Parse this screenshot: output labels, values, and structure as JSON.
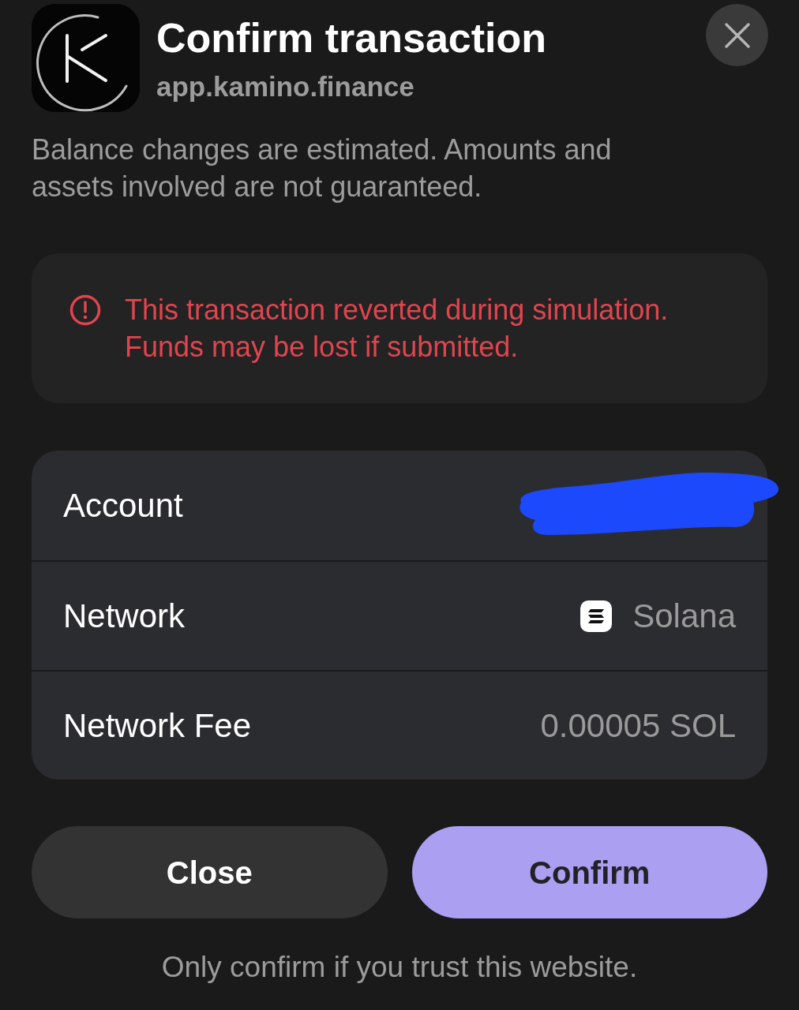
{
  "header": {
    "title": "Confirm transaction",
    "site": "app.kamino.finance"
  },
  "notice": "Balance changes are estimated. Amounts and assets involved are not guaranteed.",
  "warning": {
    "text": "This transaction reverted during simulation. Funds may be lost if submitted."
  },
  "details": [
    {
      "kind": "redacted",
      "label": "Account"
    },
    {
      "kind": "network",
      "label": "Network",
      "value": "Solana"
    },
    {
      "kind": "plain",
      "label": "Network Fee",
      "value": "0.00005 SOL"
    }
  ],
  "buttons": [
    {
      "kind": "secondary",
      "label": "Close"
    },
    {
      "kind": "primary",
      "label": "Confirm"
    }
  ],
  "footer": "Only confirm if you trust this website."
}
